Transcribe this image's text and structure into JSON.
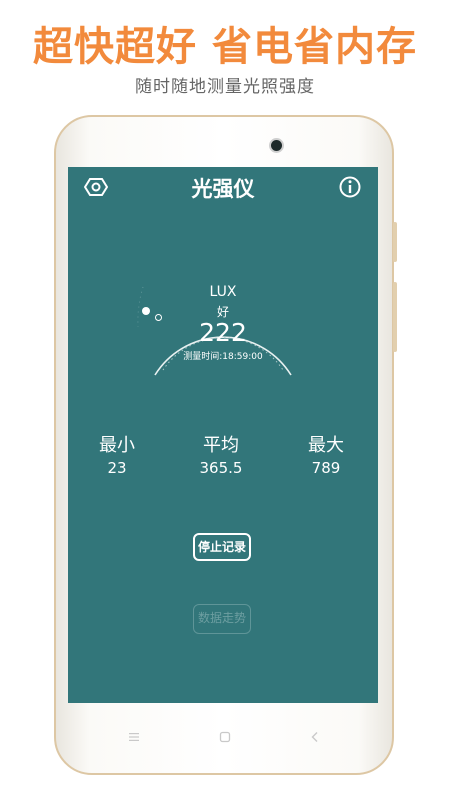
{
  "promo": {
    "headline": "超快超好 省电省内存",
    "subtitle": "随时随地测量光照强度"
  },
  "app": {
    "title": "光强仪",
    "settings_icon": "hexagon-settings-icon",
    "info_icon": "info-icon"
  },
  "gauge": {
    "unit": "LUX",
    "quality": "好",
    "value": "222",
    "time_label": "测量时间:18:59:00"
  },
  "stats": {
    "min_label": "最小",
    "min_value": "23",
    "avg_label": "平均",
    "avg_value": "365.5",
    "max_label": "最大",
    "max_value": "789"
  },
  "buttons": {
    "stop_record": "停止记录",
    "data_trend": "数据走势"
  },
  "colors": {
    "promo_orange": "#f28a3c",
    "screen_teal": "#32767a",
    "phone_gold": "#ddc7a4"
  }
}
